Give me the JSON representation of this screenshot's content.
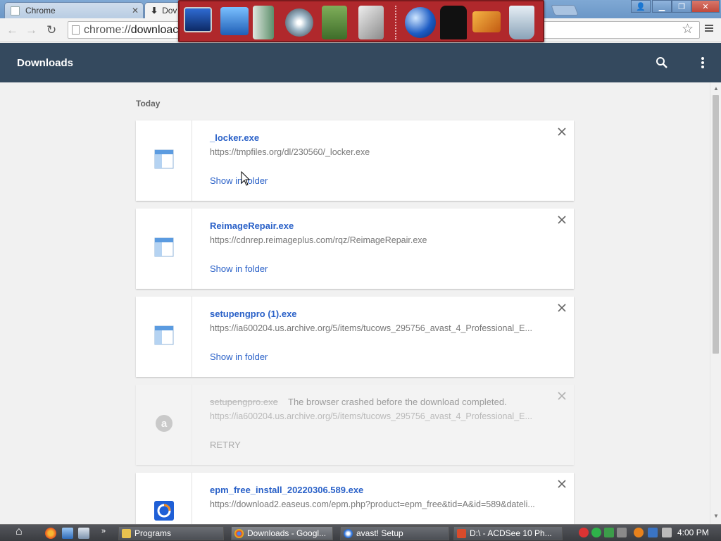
{
  "browser": {
    "tabs": [
      {
        "label": "Chrome",
        "active": false
      },
      {
        "label": "Dov",
        "active": true
      }
    ],
    "address_bar": {
      "scheme": "chrome://",
      "text": "downloac"
    }
  },
  "header": {
    "title": "Downloads"
  },
  "section_label": "Today",
  "downloads": [
    {
      "name": "_locker.exe",
      "url": "https://tmpfiles.org/dl/230560/_locker.exe",
      "action": "Show in folder",
      "status": "",
      "icon": "exe-window-icon",
      "failed": false
    },
    {
      "name": "ReimageRepair.exe",
      "url": "https://cdnrep.reimageplus.com/rqz/ReimageRepair.exe",
      "action": "Show in folder",
      "status": "",
      "icon": "exe-window-icon",
      "failed": false
    },
    {
      "name": "setupengpro (1).exe",
      "url": "https://ia600204.us.archive.org/5/items/tucows_295756_avast_4_Professional_E...",
      "action": "Show in folder",
      "status": "",
      "icon": "exe-window-icon",
      "failed": false
    },
    {
      "name": "setupengpro.exe",
      "url": "https://ia600204.us.archive.org/5/items/tucows_295756_avast_4_Professional_E...",
      "action": "RETRY",
      "status": "The browser crashed before the download completed.",
      "icon": "avast-icon",
      "failed": true
    },
    {
      "name": "epm_free_install_20220306.589.exe",
      "url": "https://download2.easeus.com/epm.php?product=epm_free&tid=A&id=589&dateli...",
      "action": "",
      "status": "",
      "icon": "easeus-icon",
      "failed": false
    }
  ],
  "taskbar": {
    "items": [
      {
        "label": "Programs",
        "icon": "folder-icon"
      },
      {
        "label": "Downloads - Googl...",
        "icon": "chrome-icon"
      },
      {
        "label": "avast! Setup",
        "icon": "avast-setup-icon"
      },
      {
        "label": "D:\\ - ACDSee 10 Ph...",
        "icon": "acdsee-icon"
      }
    ],
    "clock": "4:00 PM"
  },
  "colors": {
    "header_bg": "#34495e",
    "link": "#2a61c8",
    "launcher_bg": "#b0282c"
  }
}
